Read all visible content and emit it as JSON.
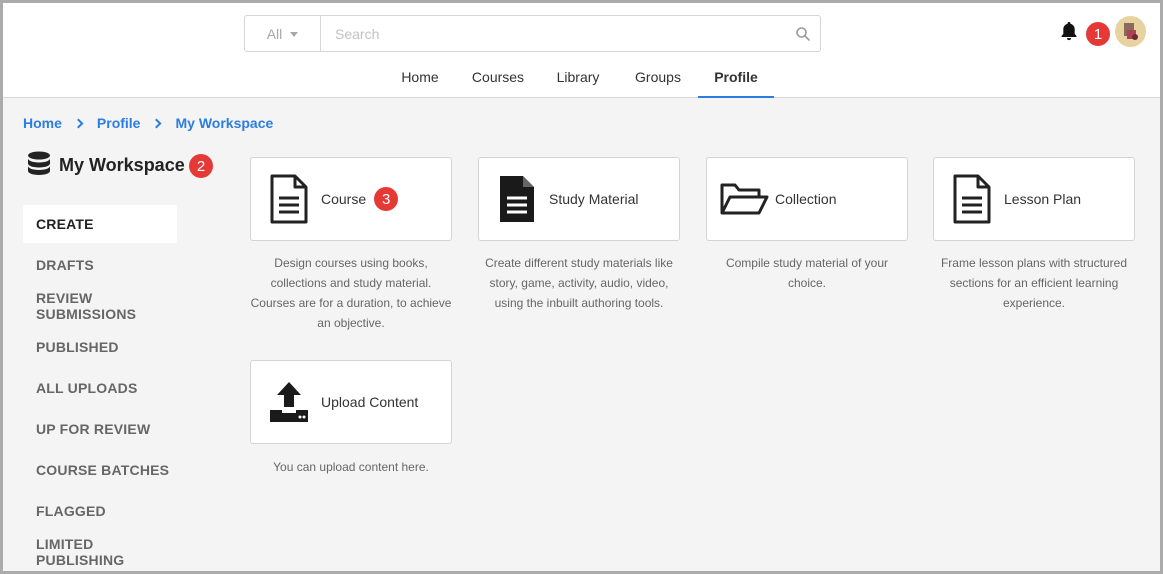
{
  "header": {
    "search": {
      "scope": "All",
      "placeholder": "Search"
    },
    "notifications_badge": "1",
    "nav": [
      {
        "label": "Home"
      },
      {
        "label": "Courses"
      },
      {
        "label": "Library"
      },
      {
        "label": "Groups"
      },
      {
        "label": "Profile",
        "active": true
      }
    ]
  },
  "breadcrumb": [
    "Home",
    "Profile",
    "My Workspace"
  ],
  "sidebar": {
    "title": "My Workspace",
    "title_badge": "2",
    "items": [
      {
        "label": "CREATE",
        "active": true
      },
      {
        "label": "DRAFTS"
      },
      {
        "label": "REVIEW SUBMISSIONS"
      },
      {
        "label": "PUBLISHED"
      },
      {
        "label": "ALL UPLOADS"
      },
      {
        "label": "UP FOR REVIEW"
      },
      {
        "label": "COURSE BATCHES"
      },
      {
        "label": "FLAGGED"
      },
      {
        "label": "LIMITED PUBLISHING"
      }
    ]
  },
  "cards": [
    {
      "label": "Course",
      "badge": "3",
      "icon": "document-outline-icon",
      "description": "Design courses using books, collections and study material. Courses are for a duration, to achieve an objective."
    },
    {
      "label": "Study Material",
      "icon": "document-filled-icon",
      "description": "Create different study materials like story, game, activity, audio, video, using the inbuilt authoring tools."
    },
    {
      "label": "Collection",
      "icon": "folder-open-icon",
      "description": "Compile study material of your choice."
    },
    {
      "label": "Lesson Plan",
      "icon": "document-outline-icon",
      "description": "Frame lesson plans with structured sections for an efficient learning experience."
    },
    {
      "label": "Upload Content",
      "icon": "upload-icon",
      "description": "You can upload content here."
    }
  ],
  "colors": {
    "accent": "#2b7de1",
    "badge": "#e53935",
    "text": "#333333"
  }
}
